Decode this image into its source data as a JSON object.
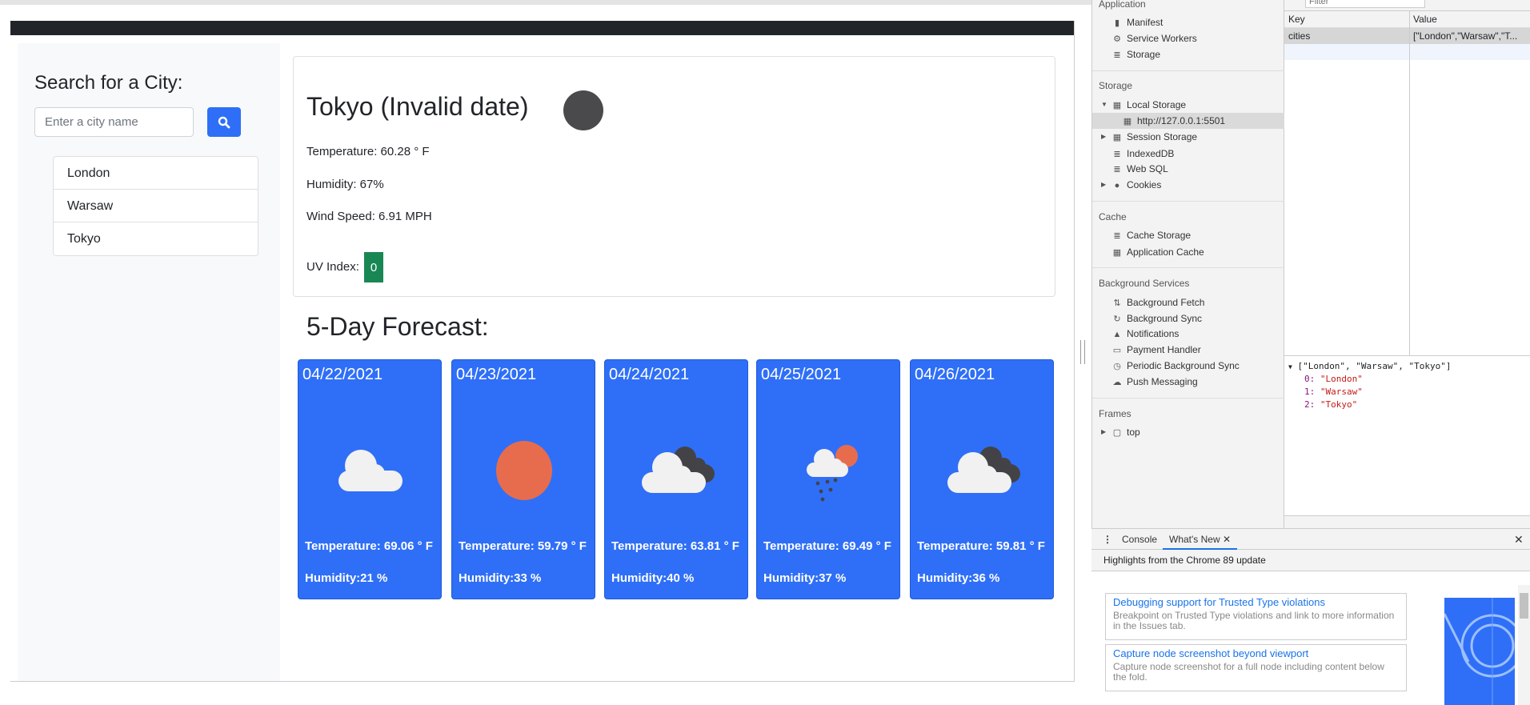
{
  "app": {
    "sidebar": {
      "title": "Search for a City:",
      "search_placeholder": "Enter a city name",
      "search_icon": "search-icon",
      "cities": [
        "London",
        "Warsaw",
        "Tokyo"
      ]
    },
    "current": {
      "title": "Tokyo (Invalid date)",
      "temperature": "Temperature: 60.28 ° F",
      "humidity": "Humidity: 67%",
      "wind": "Wind Speed: 6.91 MPH",
      "uv_label": "UV Index:",
      "uv_value": "0",
      "uv_color": "#198754"
    },
    "forecast": {
      "title": "5-Day Forecast:",
      "days": [
        {
          "date": "04/22/2021",
          "icon": "cloud-icon",
          "temp": "Temperature: 69.06 ° F",
          "humidity": "Humidity:21 %"
        },
        {
          "date": "04/23/2021",
          "icon": "sun-icon",
          "temp": "Temperature: 59.79 ° F",
          "humidity": "Humidity:33 %"
        },
        {
          "date": "04/24/2021",
          "icon": "broken-clouds-icon",
          "temp": "Temperature: 63.81 ° F",
          "humidity": "Humidity:40 %"
        },
        {
          "date": "04/25/2021",
          "icon": "rain-sun-icon",
          "temp": "Temperature: 69.49 ° F",
          "humidity": "Humidity:37 %"
        },
        {
          "date": "04/26/2021",
          "icon": "broken-clouds-icon",
          "temp": "Temperature: 59.81 ° F",
          "humidity": "Humidity:36 %"
        }
      ],
      "card_color": "#2f6ff7"
    }
  },
  "devtools": {
    "filter_placeholder": "Filter",
    "sections": {
      "application": "Application",
      "manifest": "Manifest",
      "service_workers": "Service Workers",
      "storage_item": "Storage",
      "storage": "Storage",
      "local_storage": "Local Storage",
      "origin": "http://127.0.0.1:5501",
      "session_storage": "Session Storage",
      "indexeddb": "IndexedDB",
      "websql": "Web SQL",
      "cookies": "Cookies",
      "cache": "Cache",
      "cache_storage": "Cache Storage",
      "app_cache": "Application Cache",
      "bg_services": "Background Services",
      "bg_fetch": "Background Fetch",
      "bg_sync": "Background Sync",
      "notifications": "Notifications",
      "payment": "Payment Handler",
      "periodic": "Periodic Background Sync",
      "push": "Push Messaging",
      "frames": "Frames",
      "top": "top"
    },
    "table": {
      "key_header": "Key",
      "value_header": "Value",
      "row_key": "cities",
      "row_value": "[\"London\",\"Warsaw\",\"T..."
    },
    "preview": {
      "summary": "[\"London\", \"Warsaw\", \"Tokyo\"]",
      "items": [
        {
          "k": "0:",
          "v": "\"London\""
        },
        {
          "k": "1:",
          "v": "\"Warsaw\""
        },
        {
          "k": "2:",
          "v": "\"Tokyo\""
        }
      ]
    },
    "drawer": {
      "tab_console": "Console",
      "tab_whats_new": "What's New",
      "highlights": "Highlights from the Chrome 89 update",
      "cards": [
        {
          "title": "Debugging support for Trusted Type violations",
          "desc": "Breakpoint on Trusted Type violations and link to more information in the Issues tab."
        },
        {
          "title": "Capture node screenshot beyond viewport",
          "desc": "Capture node screenshot for a full node including content below the fold."
        }
      ]
    }
  }
}
